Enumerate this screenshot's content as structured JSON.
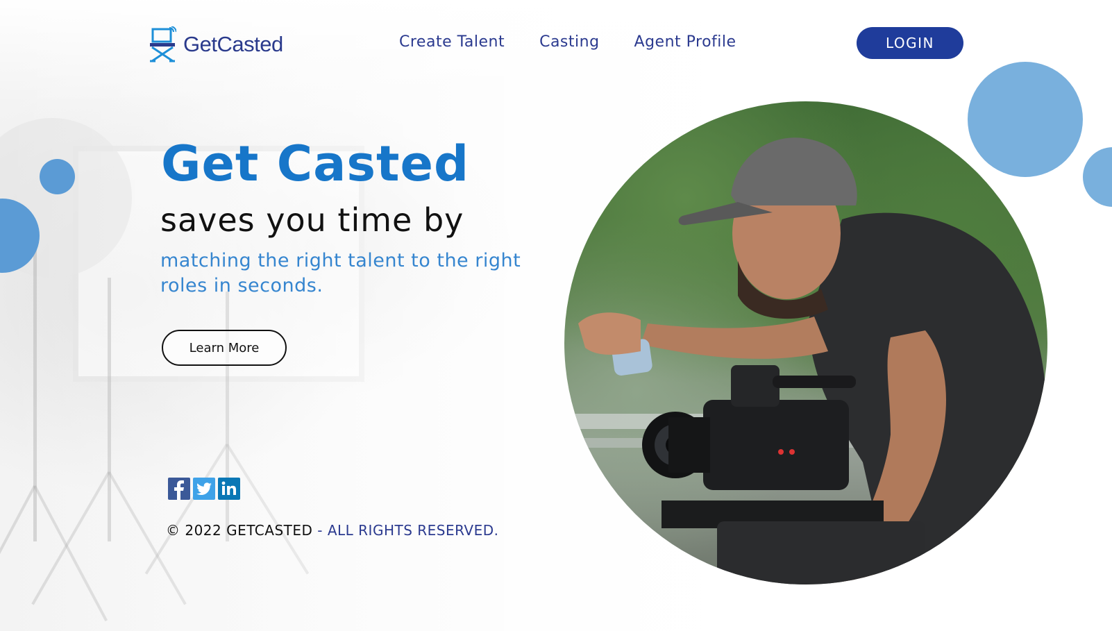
{
  "header": {
    "logo_text": "GetCasted",
    "nav": [
      {
        "label": "Create Talent"
      },
      {
        "label": "Casting"
      },
      {
        "label": "Agent Profile"
      }
    ],
    "login_label": "LOGIN"
  },
  "hero": {
    "title": "Get Casted",
    "subtitle": "saves you time by",
    "description": "matching the right talent to the right roles in seconds.",
    "cta_label": "Learn More"
  },
  "social": {
    "icons": [
      "facebook-icon",
      "twitter-icon",
      "linkedin-icon"
    ]
  },
  "footer": {
    "copyright": "© 2022 GETCASTED",
    "rights": " - ALL RIGHTS RESERVED."
  },
  "colors": {
    "brand_blue": "#1776c9",
    "nav_navy": "#2b3a8f",
    "login_bg": "#1f3c9b",
    "accent_circle": "#79b0dd"
  }
}
